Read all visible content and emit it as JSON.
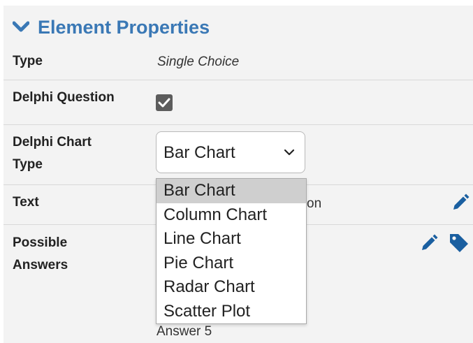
{
  "header": {
    "title": "Element Properties",
    "icon": "chevron-down-icon"
  },
  "rows": {
    "type": {
      "label": "Type",
      "value": "Single Choice"
    },
    "delphi_question": {
      "label": "Delphi Question",
      "checked": true
    },
    "delphi_chart_type": {
      "label_line1": "Delphi Chart",
      "label_line2": "Type",
      "selected": "Bar Chart"
    },
    "text": {
      "label": "Text",
      "value_visible": "on"
    },
    "possible_answers": {
      "label_line1": "Possible",
      "label_line2": "Answers",
      "last_visible_answer": "Answer 5"
    }
  },
  "dropdown": {
    "options": [
      "Bar Chart",
      "Column Chart",
      "Line Chart",
      "Pie Chart",
      "Radar Chart",
      "Scatter Plot"
    ],
    "selected_index": 0
  },
  "colors": {
    "accent": "#3a78b5",
    "panel": "#f3f3f3",
    "icon": "#1a5fa0"
  }
}
